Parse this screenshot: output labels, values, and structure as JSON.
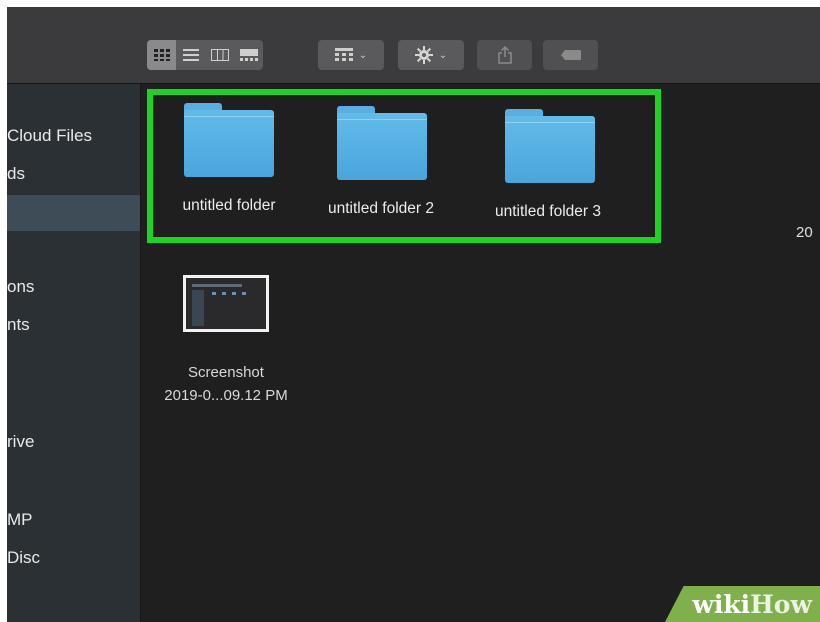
{
  "toolbar": {
    "view_buttons": [
      "icon-view-icon",
      "list-view-icon",
      "column-view-icon",
      "gallery-view-icon"
    ],
    "group_icon": "grid-group-icon",
    "action_icon": "gear-icon",
    "share_icon": "share-icon",
    "tag_icon": "tag-icon"
  },
  "sidebar": {
    "items": [
      {
        "label": "Cloud Files"
      },
      {
        "label": "ds"
      },
      {
        "label": ""
      },
      {
        "label": "ons"
      },
      {
        "label": "nts"
      },
      {
        "label": "rive"
      },
      {
        "label": "MP"
      },
      {
        "label": "Disc"
      }
    ]
  },
  "main": {
    "folders": [
      {
        "name": "untitled folder"
      },
      {
        "name": "untitled folder 2"
      },
      {
        "name": "untitled folder 3"
      }
    ],
    "file": {
      "name_line1": "Screenshot",
      "name_line2": "2019-0...09.12 PM"
    },
    "right_edge_text": "20"
  },
  "colors": {
    "highlight": "#1ed321",
    "folder": "#5aaee0",
    "selection": "#3d4c57"
  },
  "watermark": {
    "part1": "wiki",
    "part2": "How"
  }
}
